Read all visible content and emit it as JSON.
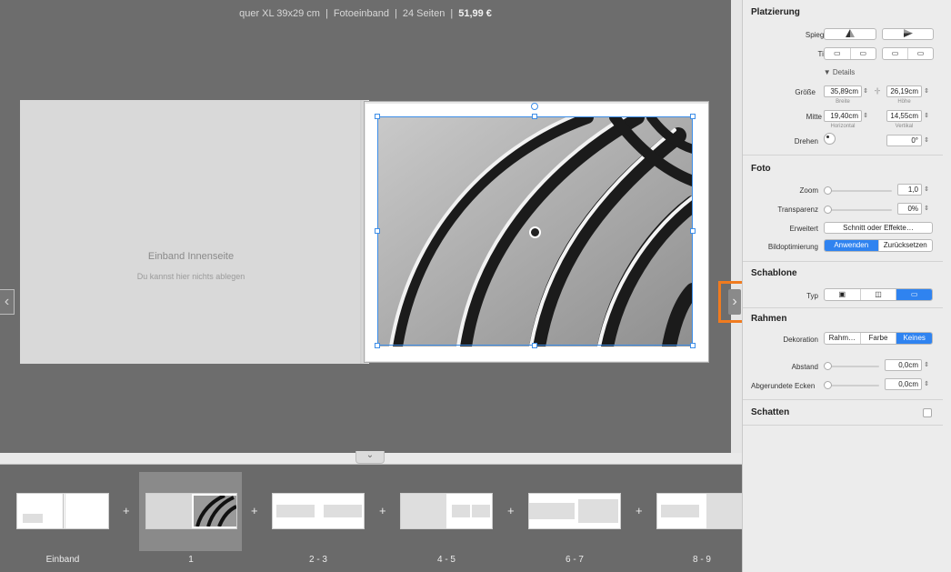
{
  "header": {
    "format": "quer XL 39x29 cm",
    "binding": "Fotoeinband",
    "pages": "24 Seiten",
    "price": "51,99 €",
    "separator": "|"
  },
  "spread": {
    "left_title": "Einband Innenseite",
    "left_hint": "Du kannst hier nichts ablegen"
  },
  "nav": {
    "prev": "‹",
    "next": "›",
    "collapse": "⌄"
  },
  "thumbnails": {
    "plus": "+",
    "labels": [
      "Einband",
      "1",
      "2 - 3",
      "4 - 5",
      "6 - 7",
      "8 - 9"
    ]
  },
  "inspector": {
    "placement": {
      "title": "Platzierung",
      "mirror_label": "Spiegeln",
      "depth_label": "Tiefe",
      "details_label": "▼ Details",
      "size_label": "Größe",
      "width_value": "35,89cm",
      "width_sub": "Breite",
      "height_value": "26,19cm",
      "height_sub": "Höhe",
      "center_label": "Mitte",
      "h_value": "19,40cm",
      "h_sub": "Horizontal",
      "v_value": "14,55cm",
      "v_sub": "Vertikal",
      "rotate_label": "Drehen",
      "rotate_value": "0°"
    },
    "photo": {
      "title": "Foto",
      "zoom_label": "Zoom",
      "zoom_value": "1,0",
      "transparency_label": "Transparenz",
      "transparency_value": "0%",
      "extended_label": "Erweitert",
      "effects_button": "Schnitt oder Effekte…",
      "optimize_label": "Bildoptimierung",
      "apply_button": "Anwenden",
      "reset_button": "Zurücksetzen"
    },
    "template": {
      "title": "Schablone",
      "type_label": "Typ"
    },
    "frame": {
      "title": "Rahmen",
      "decoration_label": "Dekoration",
      "options": [
        "Rahm…",
        "Farbe",
        "Keines"
      ],
      "distance_label": "Abstand",
      "distance_value": "0,0cm",
      "corners_label": "Abgerundete Ecken",
      "corners_value": "0,0cm"
    },
    "shadow": {
      "title": "Schatten"
    }
  },
  "colors": {
    "selection": "#3d8ee8",
    "highlight": "#f07b1f",
    "accent": "#2f83f0"
  }
}
